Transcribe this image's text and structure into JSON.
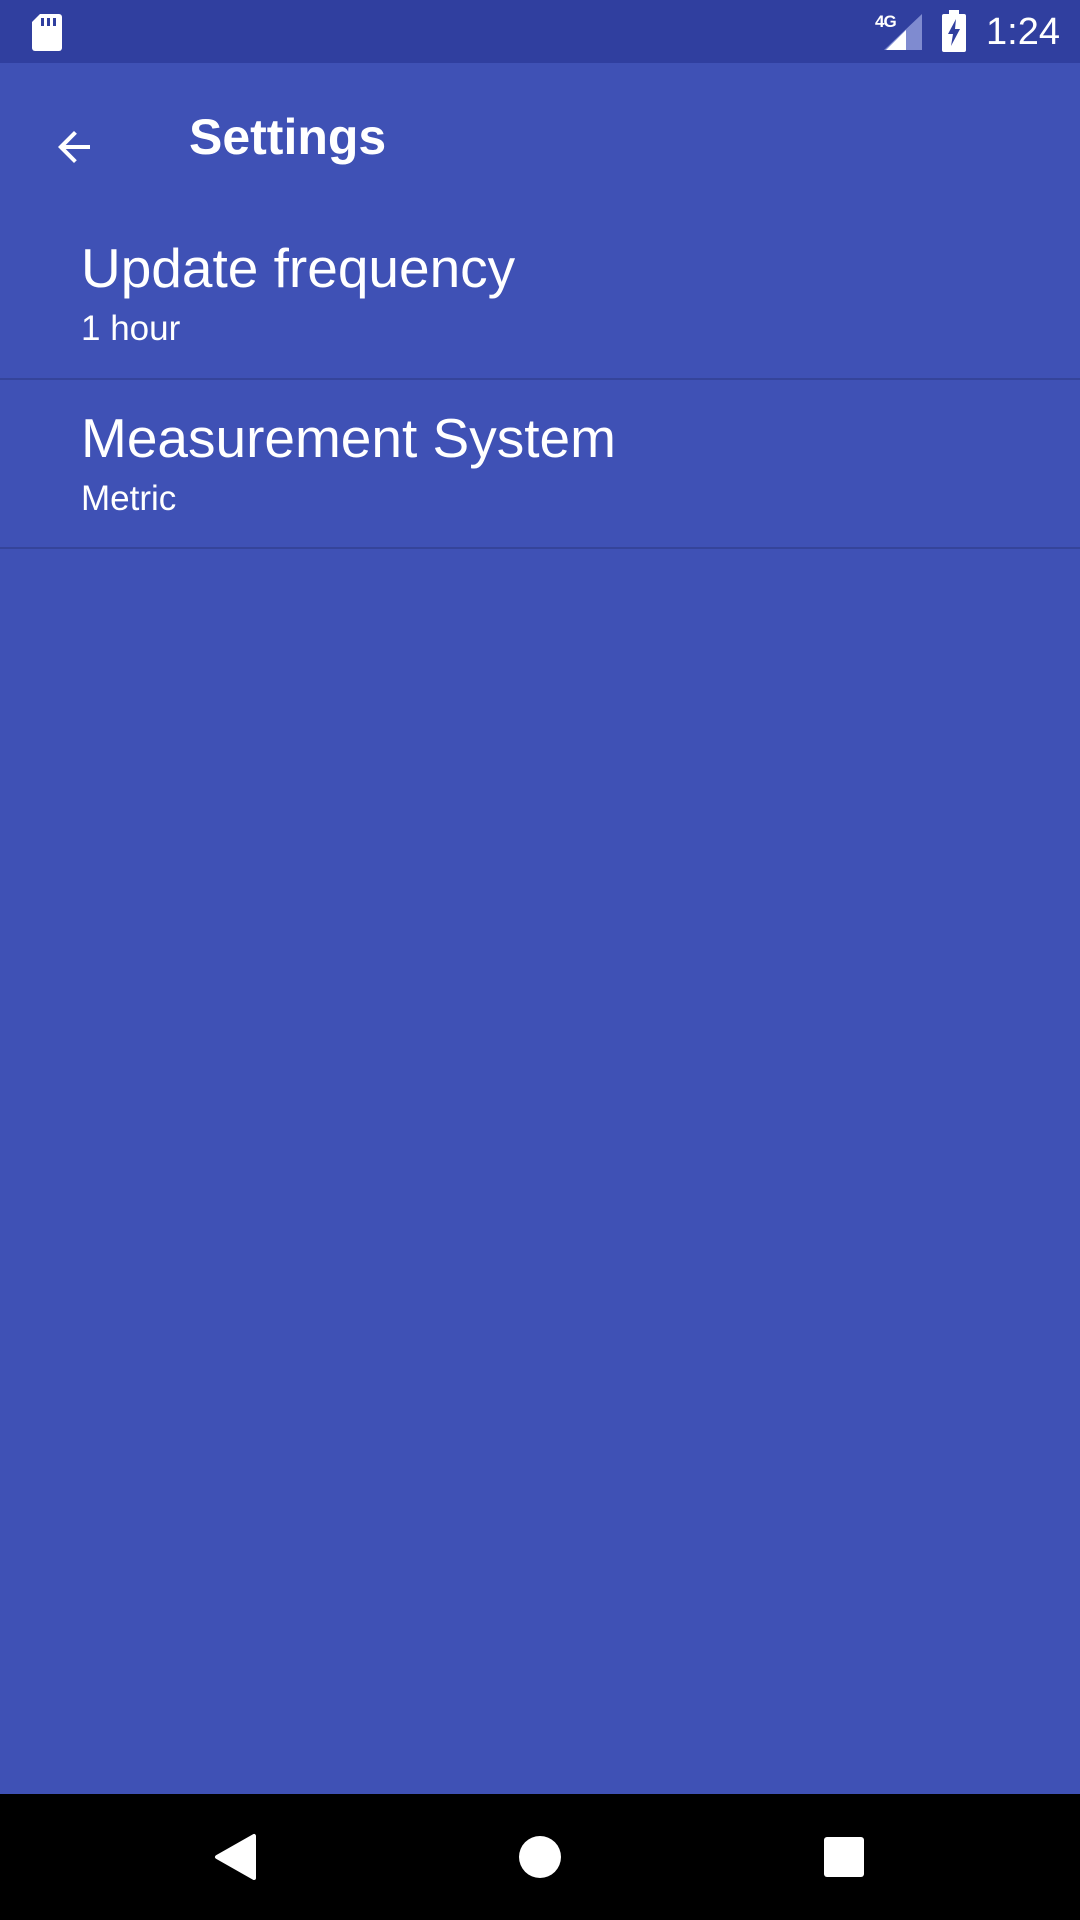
{
  "status_bar": {
    "time": "1:24",
    "network_type": "4G",
    "icons": [
      "sd-card-icon",
      "signal-icon",
      "battery-charging-icon"
    ]
  },
  "toolbar": {
    "title": "Settings",
    "back_icon": "arrow-back-icon"
  },
  "preferences": [
    {
      "title": "Update frequency",
      "summary": "1 hour"
    },
    {
      "title": "Measurement System",
      "summary": "Metric"
    }
  ],
  "nav_bar": {
    "icons": [
      "nav-back-icon",
      "nav-home-icon",
      "nav-recents-icon"
    ]
  },
  "colors": {
    "primary": "#3f51b5",
    "primary_dark": "#303f9f",
    "divider": "#35449a",
    "text": "#ffffff",
    "nav_bar": "#000000"
  }
}
